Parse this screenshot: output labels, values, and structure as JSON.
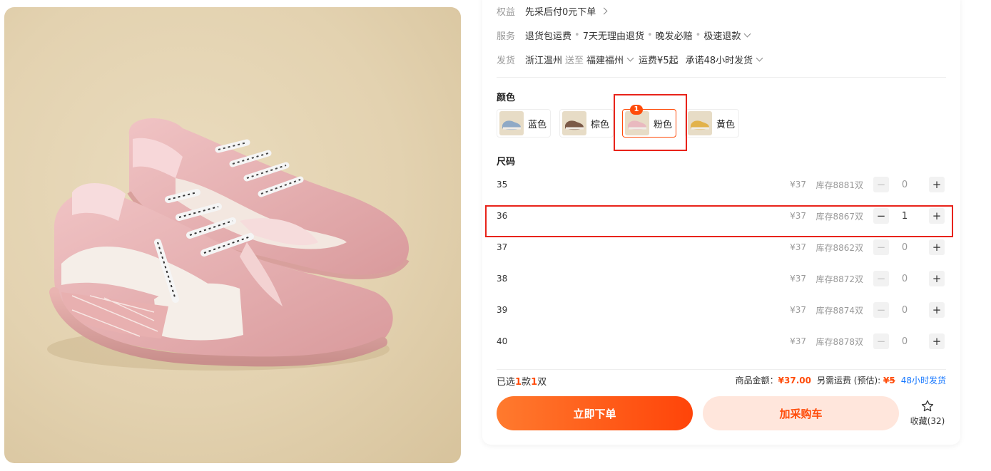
{
  "benefit": {
    "label": "权益",
    "text": "先采后付0元下单"
  },
  "service": {
    "label": "服务",
    "items": [
      "退货包运费",
      "7天无理由退货",
      "晚发必赔",
      "极速退款"
    ]
  },
  "delivery": {
    "label": "发货",
    "from": "浙江温州",
    "to_word": "送至",
    "to": "福建福州",
    "fee": "运费¥5起",
    "promise": "承诺48小时发货"
  },
  "colors": {
    "title": "颜色",
    "options": [
      {
        "label": "蓝色",
        "swatch": "#8fa9c6"
      },
      {
        "label": "棕色",
        "swatch": "#7b5a48"
      },
      {
        "label": "粉色",
        "swatch": "#e9b9bf",
        "badge": "1"
      },
      {
        "label": "黄色",
        "swatch": "#e2b24a"
      }
    ]
  },
  "sizes": {
    "title": "尺码",
    "rows": [
      {
        "size": "35",
        "price": "¥37",
        "stock": "库存8881双",
        "qty": "0"
      },
      {
        "size": "36",
        "price": "¥37",
        "stock": "库存8867双",
        "qty": "1"
      },
      {
        "size": "37",
        "price": "¥37",
        "stock": "库存8862双",
        "qty": "0"
      },
      {
        "size": "38",
        "price": "¥37",
        "stock": "库存8872双",
        "qty": "0"
      },
      {
        "size": "39",
        "price": "¥37",
        "stock": "库存8874双",
        "qty": "0"
      },
      {
        "size": "40",
        "price": "¥37",
        "stock": "库存8878双",
        "qty": "0"
      }
    ],
    "minus": "−",
    "plus": "+"
  },
  "summary": {
    "prefix": "已选",
    "kinds": "1",
    "kinds_unit": "款",
    "pairs": "1",
    "pairs_unit": "双",
    "amount_label": "商品金额：",
    "amount": "¥37.00",
    "shipping_label": "另需运费 (预估):",
    "shipping_fee": "¥5",
    "ship_time": "48小时发货"
  },
  "actions": {
    "buy": "立即下单",
    "cart": "加采购车",
    "favorite": "收藏(32)"
  },
  "colors_theme": {
    "accent": "#ff4c0a",
    "highlight": "#e8231a",
    "link": "#1677ff"
  }
}
